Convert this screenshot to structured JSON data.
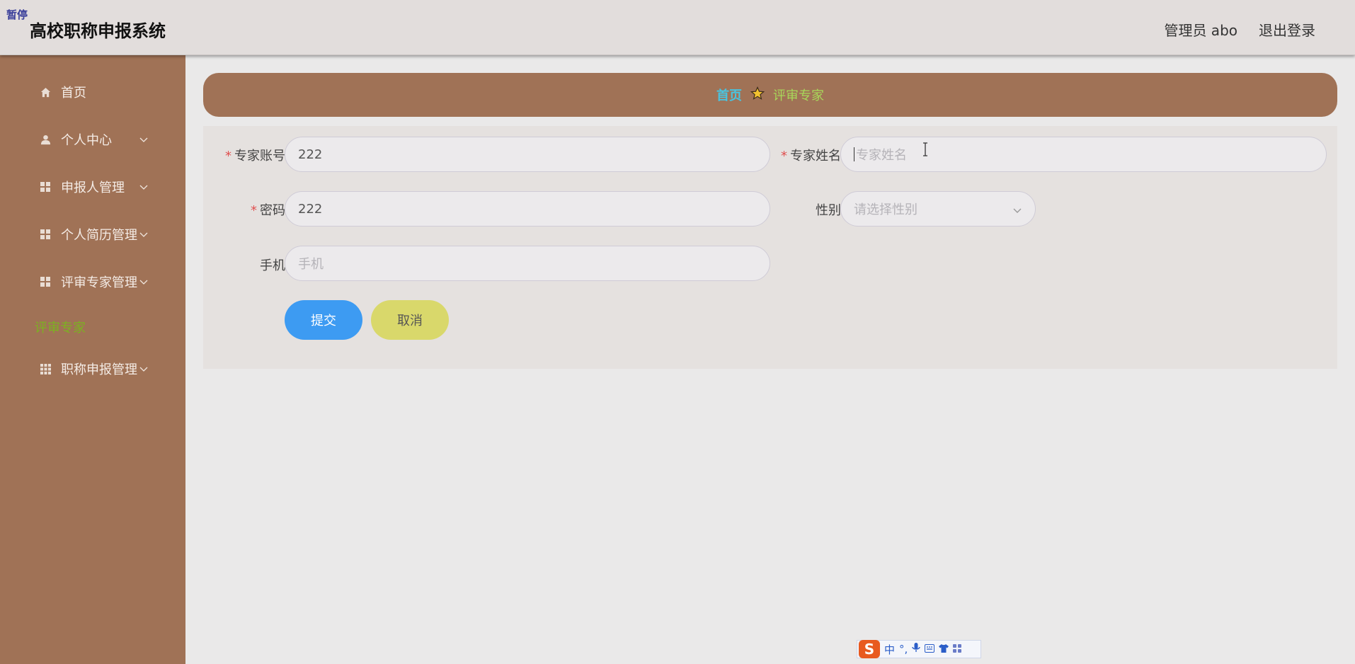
{
  "header": {
    "pause_tag": "暂停",
    "app_title": "高校职称申报系统",
    "user_label": "管理员 abo",
    "logout_label": "退出登录"
  },
  "sidebar": {
    "items": [
      {
        "label": "首页",
        "icon": "home-icon"
      },
      {
        "label": "个人中心",
        "icon": "user-icon"
      },
      {
        "label": "申报人管理",
        "icon": "grid-icon"
      },
      {
        "label": "个人简历管理",
        "icon": "grid-icon"
      },
      {
        "label": "评审专家管理",
        "icon": "grid-icon"
      },
      {
        "label": "职称申报管理",
        "icon": "grid-icon"
      }
    ],
    "active_sub": "评审专家"
  },
  "breadcrumb": {
    "home": "首页",
    "current": "评审专家",
    "separator_icon": "star-icon"
  },
  "form": {
    "account": {
      "label": "专家账号",
      "value": "222",
      "required": true
    },
    "name": {
      "label": "专家姓名",
      "placeholder": "专家姓名",
      "value": "",
      "required": true
    },
    "password": {
      "label": "密码",
      "value": "222",
      "required": true
    },
    "gender": {
      "label": "性别",
      "placeholder": "请选择性别"
    },
    "phone": {
      "label": "手机",
      "placeholder": "手机"
    },
    "submit_label": "提交",
    "cancel_label": "取消",
    "required_mark": "*"
  },
  "ime": {
    "mode": "中",
    "punct": "°,"
  },
  "colors": {
    "sidebar_bg": "#a07256",
    "submit": "#3d9bf2",
    "cancel": "#d9d86b",
    "crumb_home": "#49c4e0",
    "crumb_current": "#a8d85a"
  }
}
